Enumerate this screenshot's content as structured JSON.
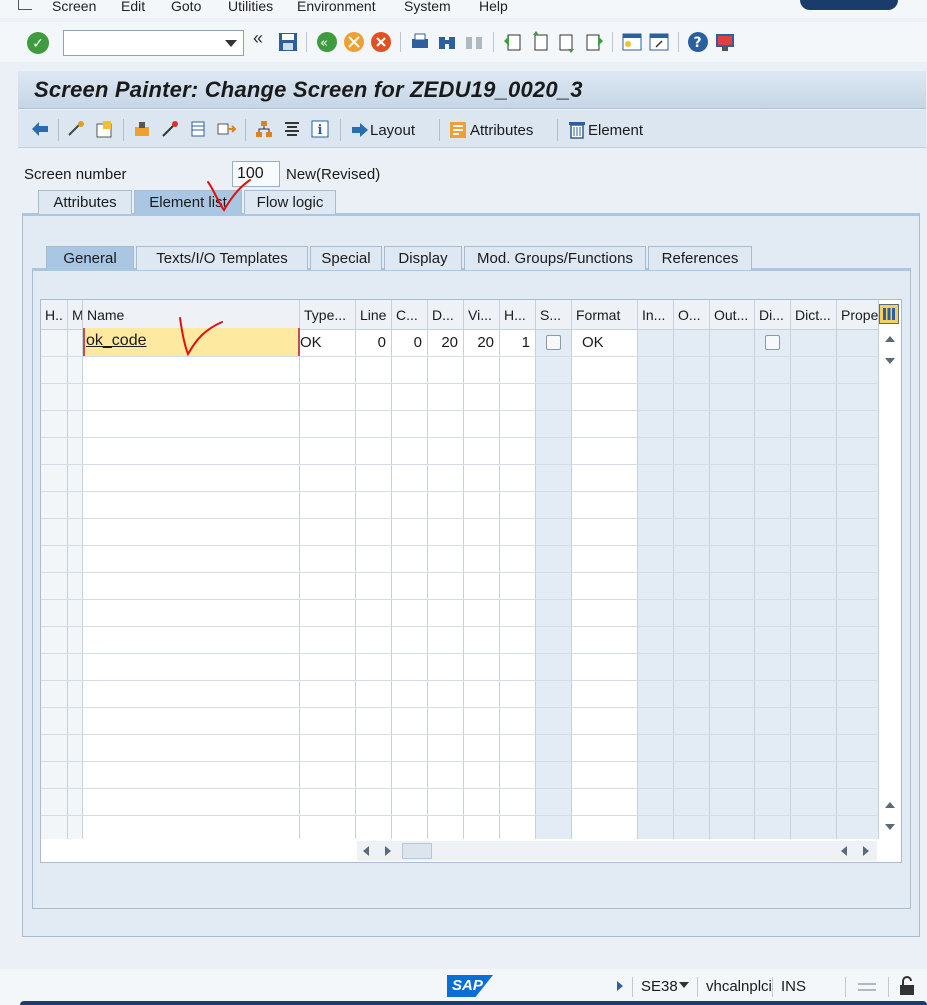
{
  "menubar": {
    "items": [
      "Screen",
      "Edit",
      "Goto",
      "Utilities",
      "Environment",
      "System",
      "Help"
    ]
  },
  "title": "Screen Painter: Change Screen for ZEDU19_0020_3",
  "app_toolbar": {
    "layout_label": "Layout",
    "attributes_label": "Attributes",
    "element_label": "Element"
  },
  "screen_number": {
    "label": "Screen number",
    "value": "100",
    "status": "New(Revised)"
  },
  "outer_tabs": [
    "Attributes",
    "Element list",
    "Flow logic"
  ],
  "outer_active_tab": "Element list",
  "inner_tabs": [
    "General",
    "Texts/I/O Templates",
    "Special",
    "Display",
    "Mod. Groups/Functions",
    "References"
  ],
  "inner_active_tab": "General",
  "table": {
    "headers": [
      "H..",
      "M",
      "Name",
      "Type...",
      "Line",
      "C...",
      "D...",
      "Vi...",
      "H...",
      "S...",
      "Format",
      "In...",
      "O...",
      "Out...",
      "Di...",
      "Dict...",
      "Prope"
    ],
    "rows": [
      {
        "name": "ok_code",
        "type": "OK",
        "line": "0",
        "column": "0",
        "deflg": "20",
        "visible_length": "20",
        "height": "1",
        "format": "OK"
      }
    ]
  },
  "statusbar": {
    "transaction": "SE38",
    "host": "vhcalnplci",
    "mode": "INS",
    "logo": "SAP"
  },
  "colors": {
    "title_bg": "#c6d6e6",
    "active_tab": "#a9c6e3",
    "name_highlight": "#fdeaa0",
    "annotation_red": "#e01010"
  }
}
